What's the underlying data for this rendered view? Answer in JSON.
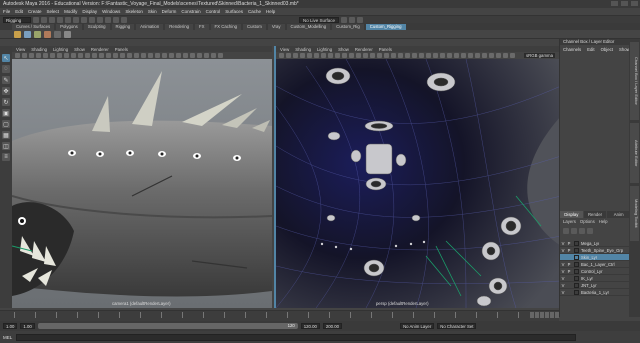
{
  "window": {
    "title": "Autodesk Maya 2016 - Educational Version: F:\\Fantastic_Voyage_Final_Models\\scenes\\Textured\\Skinned\\Bacteria_1_Skinned03.mb*"
  },
  "menubar": {
    "items": [
      "File",
      "Edit",
      "Create",
      "Select",
      "Modify",
      "Display",
      "Windows",
      "Skeleton",
      "Skin",
      "Deform",
      "Constrain",
      "Control",
      "Surfaces",
      "Cache",
      "Help"
    ]
  },
  "statusline": {
    "mode": "Rigging",
    "live_surface": "No Live Surface"
  },
  "shelf": {
    "tabs": [
      "Curves / Surfaces",
      "Polygons",
      "Sculpting",
      "Rigging",
      "Animation",
      "Rendering",
      "FX",
      "FX Caching",
      "Custom",
      "Vray",
      "Custom_Modelling",
      "Custom_Rig",
      "Custom_Rigging"
    ],
    "active_tab": "Custom_Rigging"
  },
  "viewport_left": {
    "menu": [
      "View",
      "Shading",
      "Lighting",
      "Show",
      "Renderer",
      "Panels"
    ],
    "label": "camera1 (defaultRenderLayer)"
  },
  "viewport_right": {
    "menu": [
      "View",
      "Shading",
      "Lighting",
      "Show",
      "Renderer",
      "Panels"
    ],
    "label": "persp (defaultRenderLayer)",
    "badge": "sRGB gamma"
  },
  "channel_box": {
    "header": "Channel Box / Layer Editor",
    "tabs": [
      "Channels",
      "Edit",
      "Object",
      "Show"
    ]
  },
  "layer_editor": {
    "tabs": [
      "Display",
      "Render",
      "Anim"
    ],
    "active_tab": "Display",
    "menu": [
      "Layers",
      "Options",
      "Help"
    ],
    "layers": [
      {
        "v": "V",
        "p": "P",
        "name": "Mega_Lyr",
        "color": "#3c3c3c"
      },
      {
        "v": "V",
        "p": "P",
        "name": "Teeth_Spine_Eye_Grp",
        "color": "#3c3c3c"
      },
      {
        "v": "",
        "p": "",
        "name": "Skin_Lyr",
        "color": "#5285a6"
      },
      {
        "v": "V",
        "p": "P",
        "name": "Bac_1_Layer_Ctrl",
        "color": "#3c3c3c"
      },
      {
        "v": "V",
        "p": "P",
        "name": "Control_Lyr",
        "color": "#3c3c3c"
      },
      {
        "v": "V",
        "p": "",
        "name": "IK_Lyr",
        "color": "#3c3c3c"
      },
      {
        "v": "V",
        "p": "",
        "name": "JNT_Lyr",
        "color": "#3c3c3c"
      },
      {
        "v": "V",
        "p": "",
        "name": "Bacteria_1_Lyr",
        "color": "#3c3c3c"
      }
    ],
    "highlight_index": 2
  },
  "side_tabs": [
    "Channel Box / Layer Editor",
    "Attribute Editor",
    "Modeling Toolkit"
  ],
  "time_range": {
    "start": "1.00",
    "start2": "1.00",
    "end_marker": "120",
    "end": "120.00",
    "end2": "200.00",
    "anim_layer": "No Anim Layer",
    "char_set": "No Character Set"
  },
  "command_line": {
    "label": "MEL"
  }
}
